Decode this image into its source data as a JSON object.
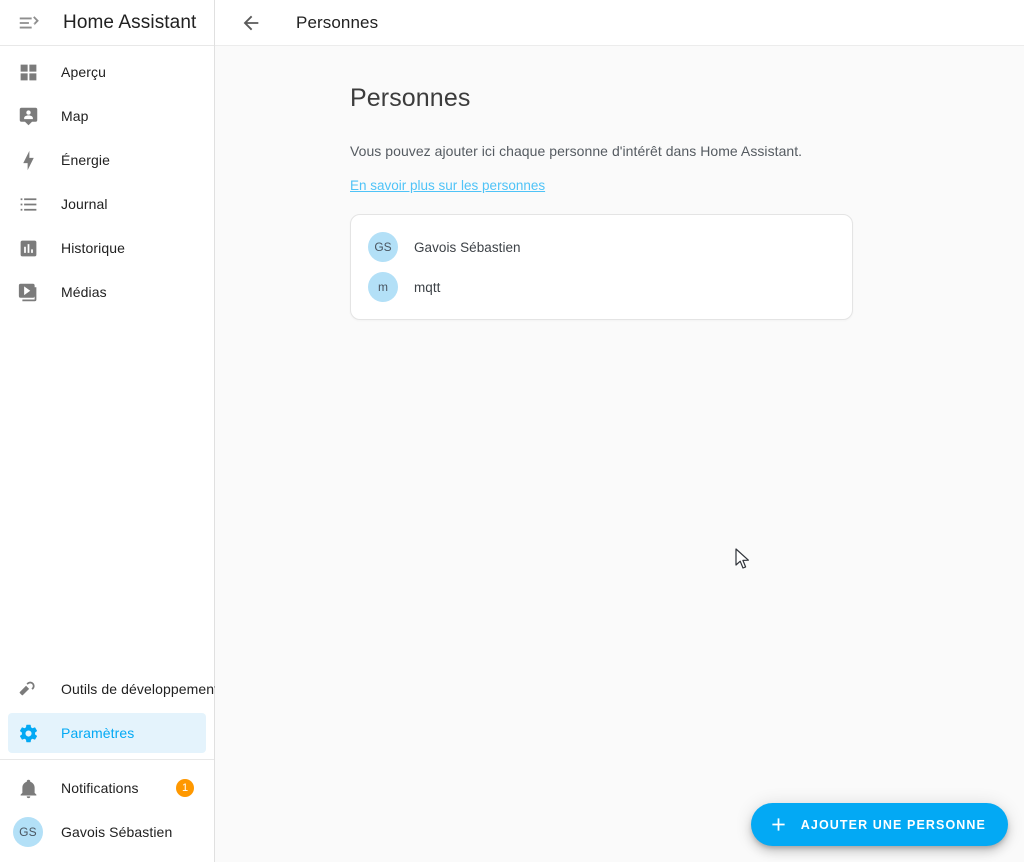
{
  "sidebar": {
    "menu_icon": "menu-open-icon",
    "title": "Home Assistant",
    "items": [
      {
        "label": "Aperçu",
        "icon": "view-dashboard-icon"
      },
      {
        "label": "Map",
        "icon": "account-badge-icon"
      },
      {
        "label": "Énergie",
        "icon": "lightning-bolt-icon"
      },
      {
        "label": "Journal",
        "icon": "format-list-bulleted-icon"
      },
      {
        "label": "Historique",
        "icon": "chart-box-icon"
      },
      {
        "label": "Médias",
        "icon": "play-box-multiple-icon"
      }
    ],
    "bottom_items": [
      {
        "label": "Outils de développement",
        "icon": "hammer-icon",
        "selected": false
      },
      {
        "label": "Paramètres",
        "icon": "cog-icon",
        "selected": true
      }
    ],
    "notifications": {
      "label": "Notifications",
      "icon": "bell-icon",
      "badge": "1",
      "badge_color": "#ff9800"
    },
    "user": {
      "name": "Gavois Sébastien",
      "initials": "GS",
      "avatar_color": "#b3e0f7"
    },
    "accent_color": "#03a9f4",
    "selected_bg_color": "#e4f3fc"
  },
  "toolbar": {
    "back_icon": "arrow-left-icon",
    "title": "Personnes"
  },
  "page": {
    "title": "Personnes",
    "description": "Vous pouvez ajouter ici chaque personne d'intérêt dans Home Assistant.",
    "link_label": "En savoir plus sur les personnes",
    "link_color": "#4fc3f7"
  },
  "persons": {
    "rows": [
      {
        "initials": "GS",
        "name": "Gavois Sébastien"
      },
      {
        "initials": "m",
        "name": "mqtt"
      }
    ],
    "avatar_color": "#b3e0f7"
  },
  "fab": {
    "icon": "plus-icon",
    "label": "AJOUTER UNE PERSONNE",
    "color": "#03a9f4"
  }
}
